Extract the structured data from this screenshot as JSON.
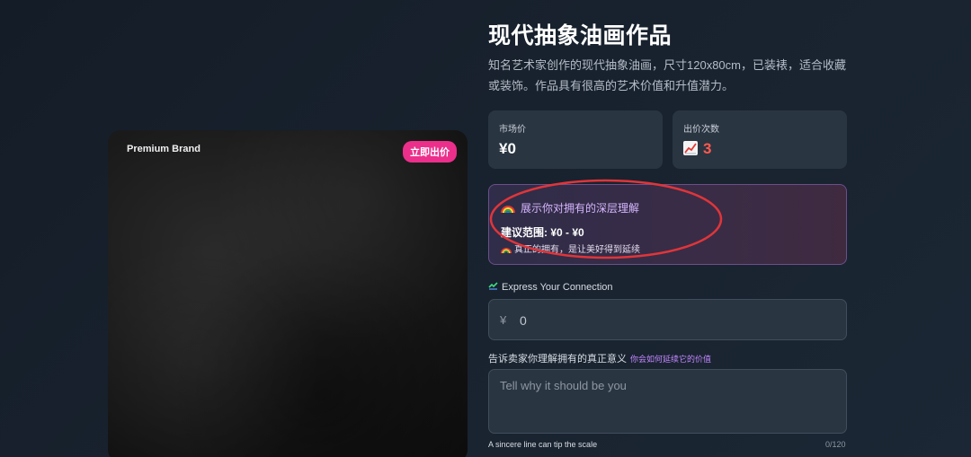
{
  "product": {
    "brand": "Premium Brand",
    "bid_badge": "立即出价",
    "title": "现代抽象油画作品",
    "description": "知名艺术家创作的现代抽象油画，尺寸120x80cm，已装裱，适合收藏或装饰。作品具有很高的艺术价值和升值潜力。"
  },
  "stats": {
    "market_price_label": "市场价",
    "market_price_value": "¥0",
    "bid_count_label": "出价次数",
    "bid_count_icon": "chart-increasing-icon",
    "bid_count_value": "3"
  },
  "insight": {
    "icon": "rainbow-icon",
    "heading": "展示你对拥有的深层理解",
    "range": "建议范围: ¥0 - ¥0",
    "note": "真正的拥有，是让美好得到延续"
  },
  "connection": {
    "label": "Express Your Connection",
    "currency_symbol": "¥",
    "amount_value": "0"
  },
  "reason": {
    "label": "告诉卖家你理解拥有的真正意义",
    "hint": "你会如何延续它的价值",
    "placeholder": "Tell why it should be you",
    "footer_left": "A sincere line can tip the scale",
    "char_count": "0/120"
  },
  "colors": {
    "accent_pink": "#ec2f8b",
    "hot_red": "#ff5a4e",
    "highlight_red": "#e0353a",
    "hint_purple": "#c486ff"
  }
}
